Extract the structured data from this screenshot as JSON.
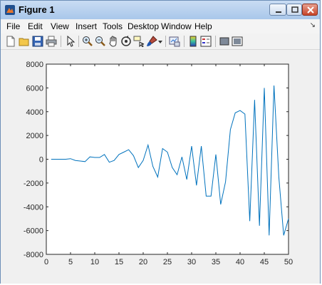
{
  "window": {
    "title": "Figure 1",
    "minimize_glyph": "",
    "maximize_glyph": "",
    "close_glyph": ""
  },
  "menu": {
    "items": [
      "File",
      "Edit",
      "View",
      "Insert",
      "Tools",
      "Desktop",
      "Window",
      "Help"
    ],
    "overflow_glyph": "↘"
  },
  "toolbar": {
    "icons": [
      "new-figure-icon",
      "open-file-icon",
      "save-icon",
      "print-icon",
      "edit-plot-icon",
      "zoom-in-icon",
      "zoom-out-icon",
      "pan-icon",
      "rotate-3d-icon",
      "data-cursor-icon",
      "brush-icon",
      "brush-dropdown-icon",
      "link-plot-icon",
      "colorbar-icon",
      "legend-icon",
      "hide-plot-tools-icon",
      "show-plot-tools-icon"
    ]
  },
  "chart_data": {
    "type": "line",
    "title": "",
    "xlabel": "",
    "ylabel": "",
    "xlim": [
      0,
      50
    ],
    "ylim": [
      -8000,
      8000
    ],
    "xticks": [
      0,
      5,
      10,
      15,
      20,
      25,
      30,
      35,
      40,
      45,
      50
    ],
    "yticks": [
      -8000,
      -6000,
      -4000,
      -2000,
      0,
      2000,
      4000,
      6000,
      8000
    ],
    "grid": false,
    "line_color": "#0072bd",
    "series": [
      {
        "x": [
          1,
          2,
          3,
          4,
          5,
          6,
          7,
          8,
          9,
          10,
          11,
          12,
          13,
          14,
          15,
          16,
          17,
          18,
          19,
          20,
          21,
          22,
          23,
          24,
          25,
          26,
          27,
          28,
          29,
          30,
          31,
          32,
          33,
          34,
          35,
          36,
          37,
          38,
          39,
          40,
          41,
          42,
          43,
          44,
          45,
          46,
          47,
          48,
          49,
          50
        ],
        "values": [
          0,
          0,
          0,
          0,
          50,
          -100,
          -150,
          -200,
          200,
          150,
          150,
          400,
          -250,
          -100,
          400,
          600,
          800,
          300,
          -700,
          -100,
          1200,
          -600,
          -1500,
          900,
          600,
          -700,
          -1300,
          200,
          -1700,
          1100,
          -2200,
          1100,
          -3100,
          -3100,
          400,
          -3800,
          -1900,
          2500,
          3900,
          4100,
          3800,
          -5200,
          5000,
          -5600,
          6000,
          -6400,
          6200,
          -1500,
          -6400,
          -5000
        ]
      }
    ]
  }
}
